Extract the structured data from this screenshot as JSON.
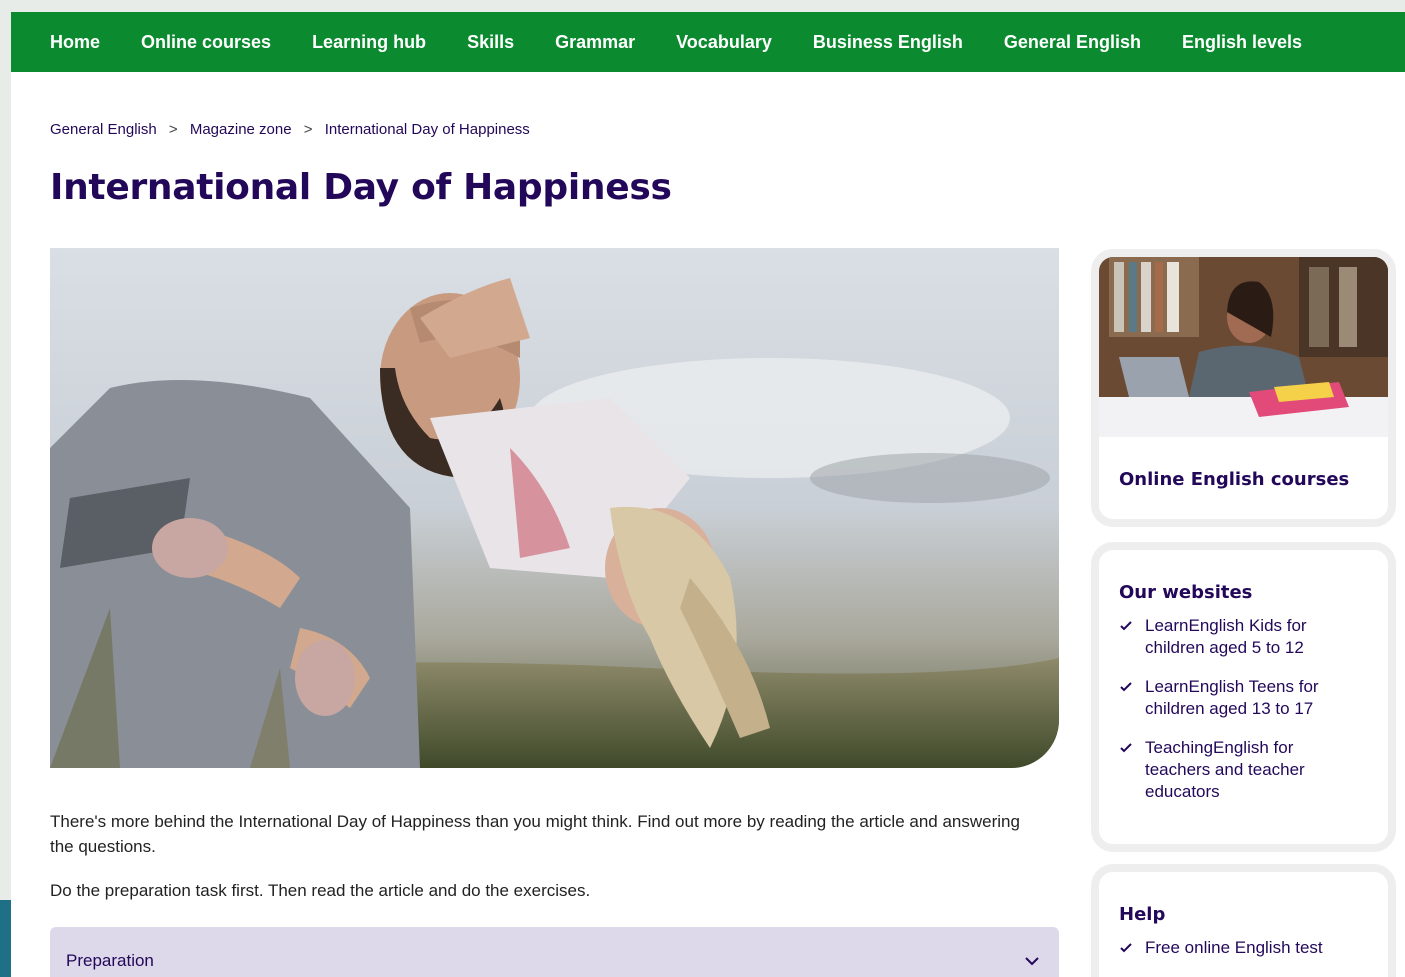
{
  "nav": {
    "items": [
      "Home",
      "Online courses",
      "Learning hub",
      "Skills",
      "Grammar",
      "Vocabulary",
      "Business English",
      "General English",
      "English levels"
    ]
  },
  "breadcrumb": {
    "items": [
      "General English",
      "Magazine zone",
      "International Day of Happiness"
    ],
    "separator": ">"
  },
  "page": {
    "title": "International Day of Happiness",
    "intro": "There's more behind the International Day of Happiness than you might think. Find out more by reading the article and answering the questions.",
    "instruction": "Do the preparation task first. Then read the article and do the exercises."
  },
  "accordion": {
    "label": "Preparation",
    "icon": "chevron-down-icon"
  },
  "sidebar": {
    "courses_card": {
      "title": "Online English courses"
    },
    "websites_card": {
      "title": "Our websites",
      "links": [
        "LearnEnglish Kids for children aged 5 to 12",
        "LearnEnglish Teens for children aged 13 to 17",
        "TeachingEnglish for teachers and teacher educators"
      ]
    },
    "help_card": {
      "title": "Help",
      "links": [
        "Free online English test"
      ]
    }
  },
  "colors": {
    "nav_bg": "#0b8a2f",
    "brand_text": "#23085a",
    "accordion_bg": "#ddd8ea"
  }
}
